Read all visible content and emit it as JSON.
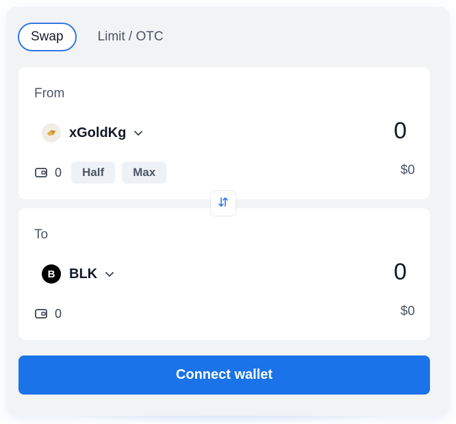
{
  "tabs": [
    {
      "label": "Swap",
      "active": true
    },
    {
      "label": "Limit / OTC",
      "active": false
    }
  ],
  "from": {
    "label": "From",
    "token": {
      "symbol": "xGoldKg",
      "icon": "gold-coin-icon"
    },
    "amount": "0",
    "balance": "0",
    "half_label": "Half",
    "max_label": "Max",
    "usd_value": "$0"
  },
  "to": {
    "label": "To",
    "token": {
      "symbol": "BLK",
      "icon": "blk-token-icon",
      "icon_letter": "B"
    },
    "amount": "0",
    "balance": "0",
    "usd_value": "$0"
  },
  "swap_direction_icon": "swap-vertical-icon",
  "connect_label": "Connect wallet",
  "colors": {
    "accent": "#1a73e8",
    "tab_border": "#2f76e0",
    "panel_bg": "#f2f3f5"
  }
}
